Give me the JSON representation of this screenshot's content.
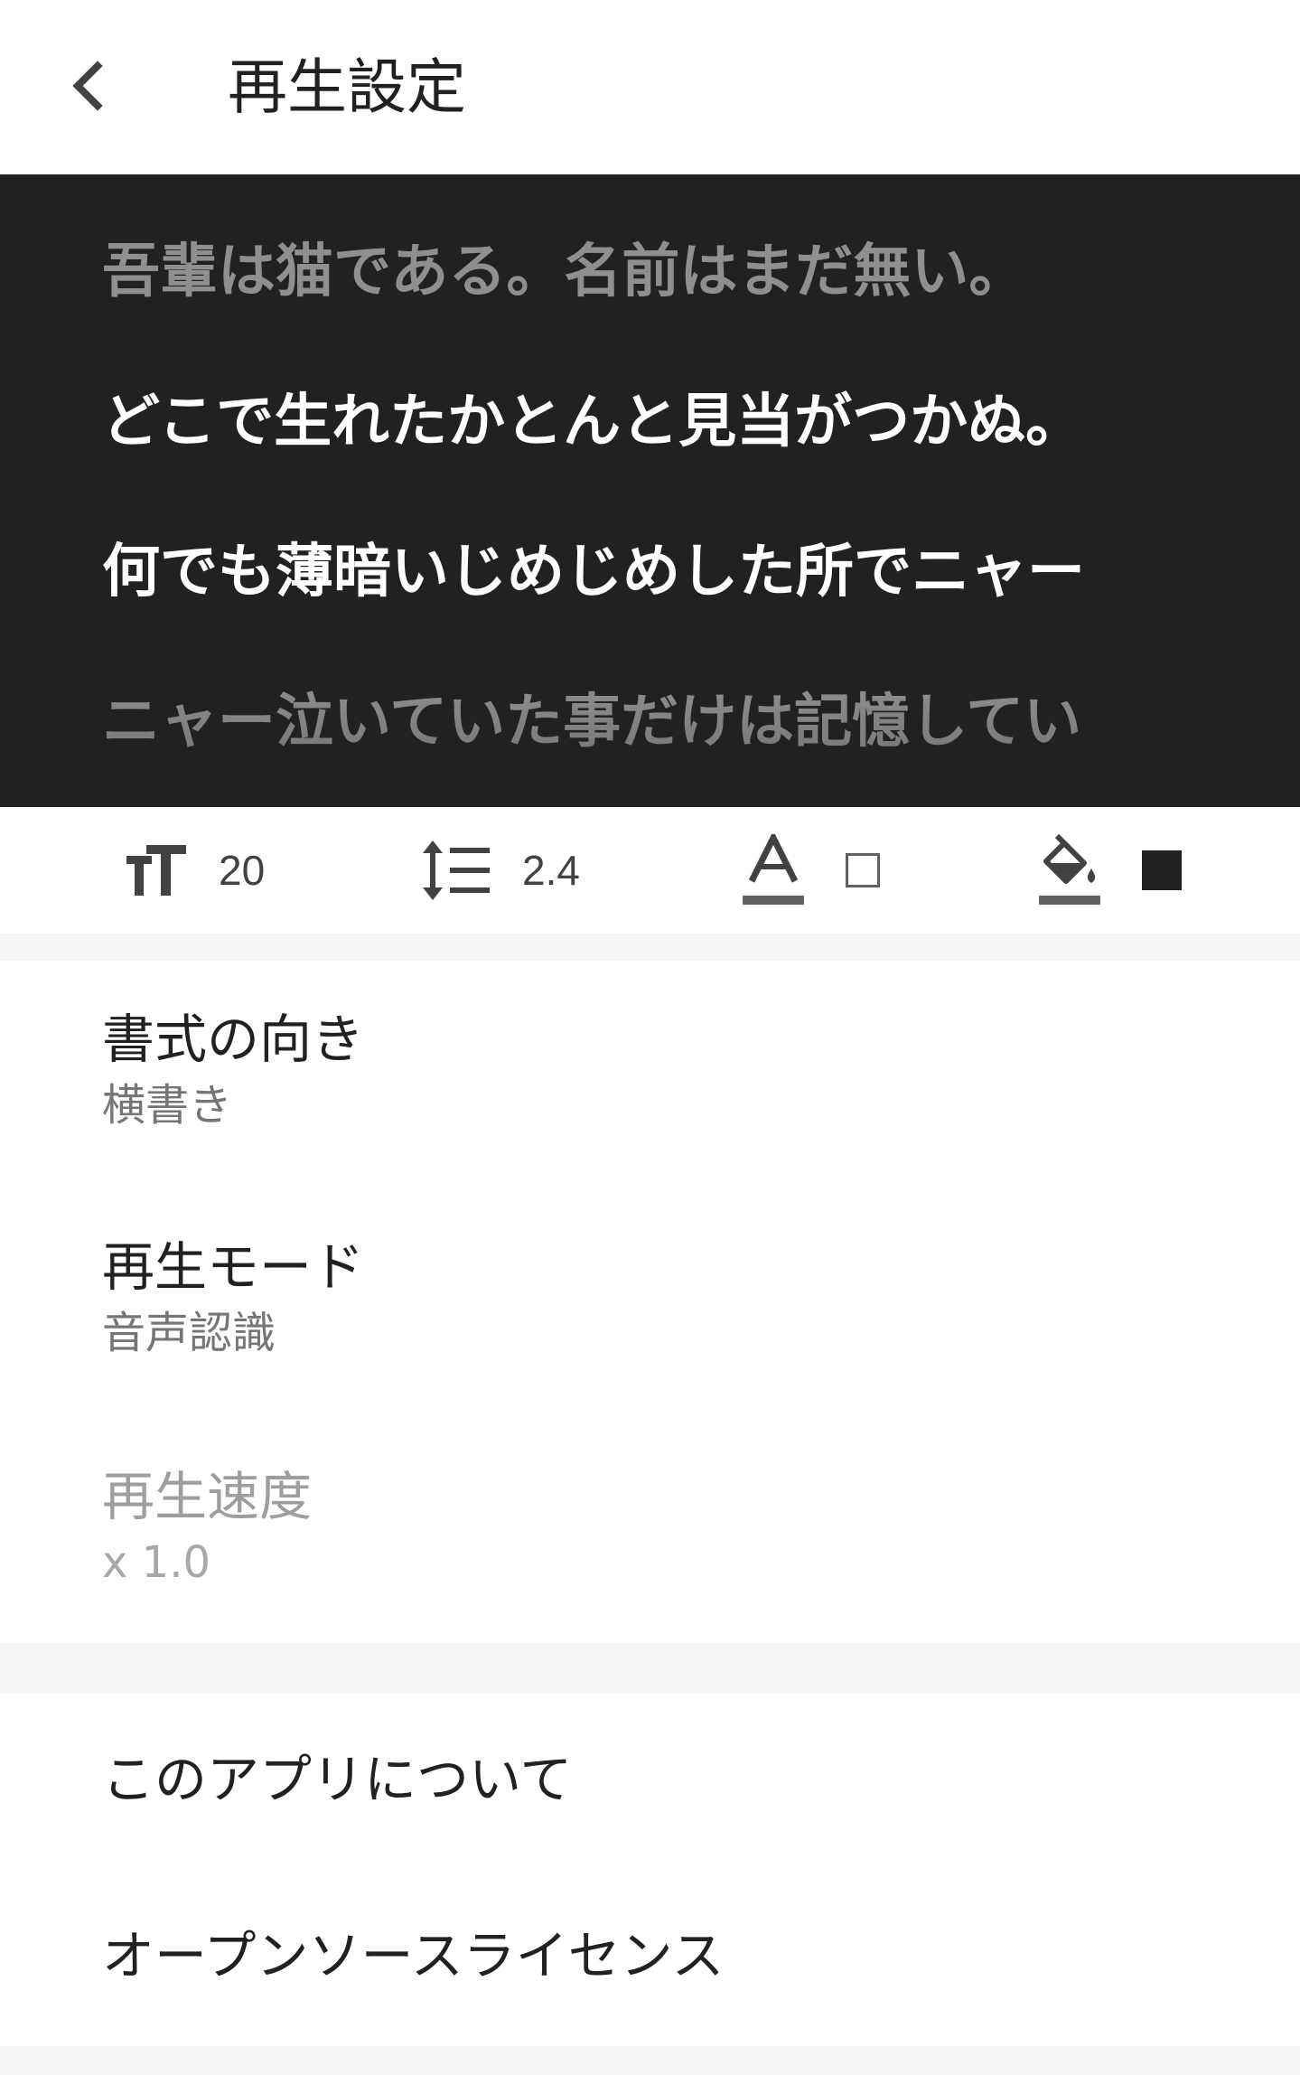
{
  "appbar": {
    "title": "再生設定",
    "back_icon": "arrow-back-icon"
  },
  "preview": {
    "lines": [
      "吾輩は猫である。名前はまだ無い。",
      "どこで生れたかとんと見当がつかぬ。",
      "何でも薄暗いじめじめした所でニャー",
      "ニャー泣いていた事だけは記憶してい"
    ],
    "background_color": "#212121",
    "highlight_color": "#ffffff",
    "dim_color": "#8f8f8f"
  },
  "toolbar": {
    "font_size": {
      "icon": "format-size-icon",
      "value": "20"
    },
    "line_spacing": {
      "icon": "format-line-spacing-icon",
      "value": "2.4"
    },
    "text_color": {
      "icon": "format-color-text-icon",
      "swatch": "#ffffff"
    },
    "background_color": {
      "icon": "format-color-fill-icon",
      "swatch": "#212121"
    }
  },
  "settings": {
    "orientation": {
      "title": "書式の向き",
      "summary": "横書き"
    },
    "playback_mode": {
      "title": "再生モード",
      "summary": "音声認識"
    },
    "playback_speed": {
      "title": "再生速度",
      "summary": "x 1.0",
      "enabled": false
    }
  },
  "about": {
    "app_info": "このアプリについて",
    "licenses": "オープンソースライセンス"
  }
}
